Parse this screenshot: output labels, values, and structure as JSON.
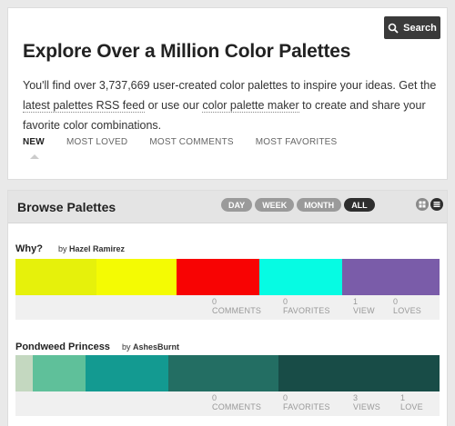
{
  "search": {
    "label": "Search"
  },
  "hero": {
    "title": "Explore Over a Million Color Palettes",
    "desc_1": "You'll find over 3,737,669 user-created color palettes to inspire your ideas. Get the ",
    "link_rss": "latest palettes RSS feed",
    "desc_2": " or use our ",
    "link_maker": "color palette maker",
    "desc_3": " to create and share your favorite color combinations."
  },
  "tabs": [
    "NEW",
    "MOST LOVED",
    "MOST COMMENTS",
    "MOST FAVORITES"
  ],
  "browse": {
    "title": "Browse Palettes",
    "filters": [
      "DAY",
      "WEEK",
      "MONTH",
      "ALL"
    ],
    "active_filter": "ALL"
  },
  "palettes": [
    {
      "name": "Why?",
      "by": "by",
      "author": "Hazel Ramirez",
      "colors": [
        {
          "hex": "#e6f10b",
          "share": 19
        },
        {
          "hex": "#f4fb03",
          "share": 19
        },
        {
          "hex": "#f80303",
          "share": 19.5
        },
        {
          "hex": "#06fbe3",
          "share": 19.5
        },
        {
          "hex": "#7a5ca9",
          "share": 23
        }
      ],
      "stats": [
        {
          "num": "0",
          "label": "COMMENTS"
        },
        {
          "num": "0",
          "label": "FAVORITES"
        },
        {
          "num": "1",
          "label": "VIEW"
        },
        {
          "num": "0",
          "label": "LOVES"
        }
      ]
    },
    {
      "name": "Pondweed Princess",
      "by": "by",
      "author": "AshesBurnt",
      "colors": [
        {
          "hex": "#c4d8c0",
          "share": 4
        },
        {
          "hex": "#5fc09a",
          "share": 12.5
        },
        {
          "hex": "#139a91",
          "share": 19.5
        },
        {
          "hex": "#236e63",
          "share": 26
        },
        {
          "hex": "#184c47",
          "share": 38
        }
      ],
      "stats": [
        {
          "num": "0",
          "label": "COMMENTS"
        },
        {
          "num": "0",
          "label": "FAVORITES"
        },
        {
          "num": "3",
          "label": "VIEWS"
        },
        {
          "num": "1",
          "label": "LOVE"
        }
      ]
    }
  ]
}
